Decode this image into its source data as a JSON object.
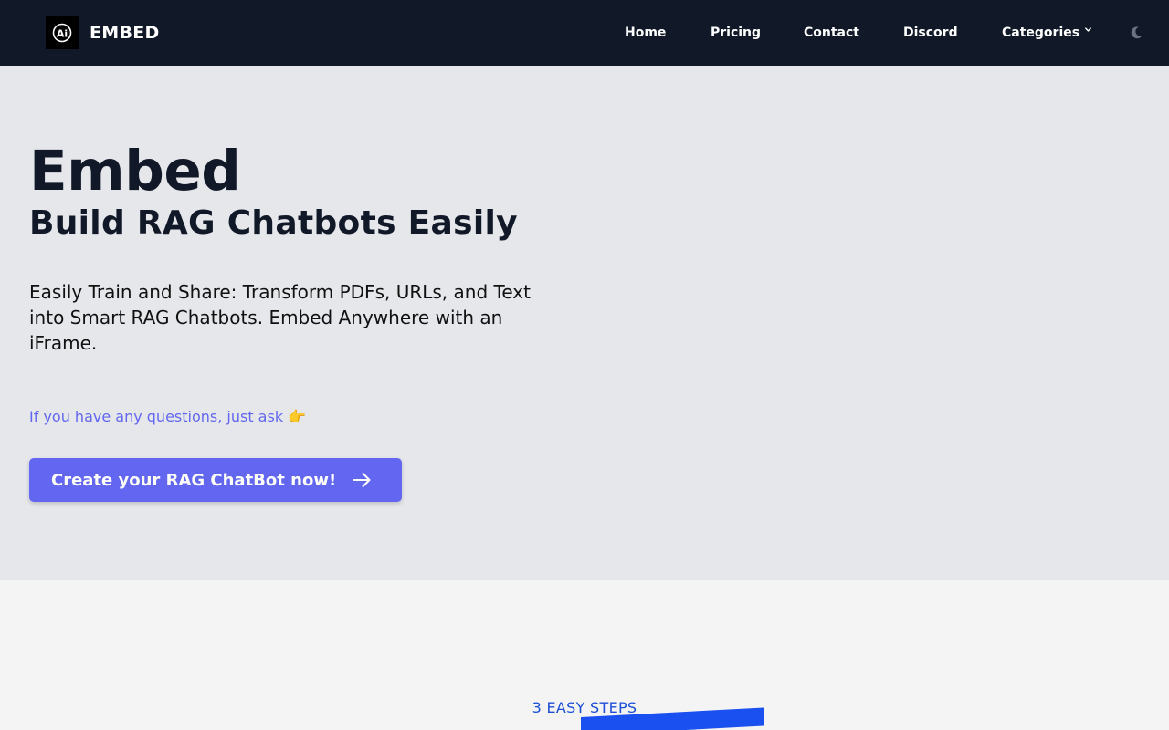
{
  "header": {
    "brand": "EMBED",
    "logo_icon": "ai-logo-icon",
    "nav": [
      {
        "label": "Home"
      },
      {
        "label": "Pricing"
      },
      {
        "label": "Contact"
      },
      {
        "label": "Discord"
      },
      {
        "label": "Categories",
        "icon": "chevron-down-icon"
      }
    ],
    "theme_toggle_icon": "moon-icon"
  },
  "hero": {
    "title": "Embed",
    "subtitle": "Build RAG Chatbots Easily",
    "description": "Easily Train and Share: Transform PDFs, URLs, and Text into Smart RAG Chatbots. Embed Anywhere with an iFrame.",
    "ask": "If you have any questions, just ask 👉",
    "cta_label": "Create your RAG ChatBot now!",
    "cta_icon": "arrow-right-icon"
  },
  "steps": {
    "eyebrow": "3 EASY STEPS"
  },
  "colors": {
    "nav_bg": "#111827",
    "hero_bg": "#e5e7eb",
    "accent": "#6366f1",
    "steps_label": "#1d4ed8",
    "highlight": "#1a4ff0"
  }
}
